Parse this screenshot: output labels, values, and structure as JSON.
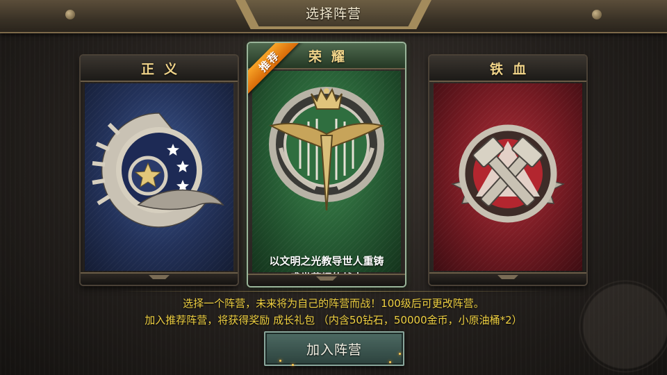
{
  "header": {
    "title": "选择阵营"
  },
  "factions": [
    {
      "name": "正义",
      "theme_color": "#2b3c6b",
      "emblem": "eagle-stars-icon"
    },
    {
      "name": "荣耀",
      "theme_color": "#2e6e3d",
      "emblem": "winged-crown-icon",
      "badge": "推荐",
      "description_line1": "以文明之光教导世人重铸",
      "description_line2": "盛世荣耀的战士"
    },
    {
      "name": "铁血",
      "theme_color": "#8a1f27",
      "emblem": "crossed-hammers-icon"
    }
  ],
  "info": {
    "line1": "选择一个阵营，未来将为自己的阵营而战！100级后可更改阵营。",
    "line2": "加入推荐阵营，将获得奖励 成长礼包 （内含50钻石，50000金币，小原油桶*2）"
  },
  "join_button": {
    "label": "加入阵营"
  },
  "colors": {
    "accent_text": "#f0d142",
    "header_text": "#f2d58a",
    "badge": "#f08a17"
  }
}
